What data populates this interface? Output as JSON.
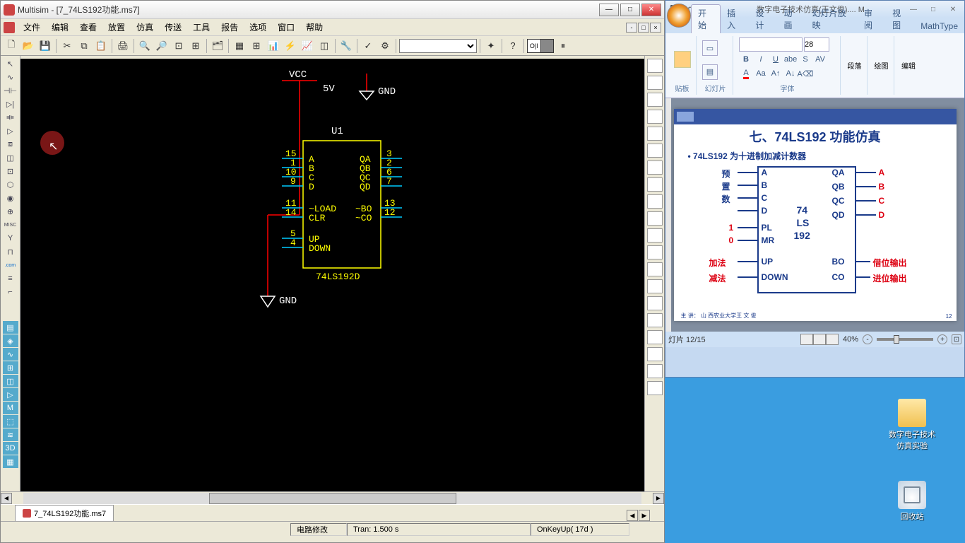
{
  "multisim": {
    "title": "Multisim - [7_74LS192功能.ms7]",
    "menus": [
      "文件",
      "编辑",
      "查看",
      "放置",
      "仿真",
      "传送",
      "工具",
      "报告",
      "选项",
      "窗口",
      "帮助"
    ],
    "file_tab": "7_74LS192功能.ms7",
    "statusbar": {
      "s1": "电路修改",
      "s2": "Tran: 1.500 s",
      "s3": "OnKeyUp( 17d )"
    },
    "circuit": {
      "vcc": "VCC",
      "vcc_val": "5V",
      "gnd": "GND",
      "ref": "U1",
      "chip": "74LS192D",
      "left_pins": [
        {
          "n": "15",
          "l": "A"
        },
        {
          "n": "1",
          "l": "B"
        },
        {
          "n": "10",
          "l": "C"
        },
        {
          "n": "9",
          "l": "D"
        },
        {
          "n": "11",
          "l": "~LOAD"
        },
        {
          "n": "14",
          "l": "CLR"
        },
        {
          "n": "5",
          "l": "UP"
        },
        {
          "n": "4",
          "l": "DOWN"
        }
      ],
      "right_pins": [
        {
          "n": "3",
          "l": "QA"
        },
        {
          "n": "2",
          "l": "QB"
        },
        {
          "n": "6",
          "l": "QC"
        },
        {
          "n": "7",
          "l": "QD"
        },
        {
          "n": "13",
          "l": "~BO"
        },
        {
          "n": "12",
          "l": "~CO"
        }
      ]
    }
  },
  "ppt": {
    "doc_title": "数字电子技术仿真(王文俊).... M",
    "tabs": [
      "开始",
      "插入",
      "设计",
      "动画",
      "幻灯片放映",
      "审阅",
      "视图",
      "MathType"
    ],
    "groups": {
      "clipboard": "贴板",
      "slides": "幻灯片",
      "font": "字体",
      "para": "段落",
      "draw": "绘图",
      "edit": "编辑"
    },
    "font_size": "28",
    "slide": {
      "title": "七、74LS192 功能仿真",
      "bullet": "• 74LS192 为十进制加减计数器",
      "left_labels_cn": [
        "预",
        "置",
        "数"
      ],
      "left_io": [
        "A",
        "B",
        "C",
        "D",
        "PL",
        "MR",
        "UP",
        "DOWN"
      ],
      "right_io": [
        "QA",
        "QB",
        "QC",
        "QD",
        "BO",
        "CO"
      ],
      "right_out": [
        "A",
        "B",
        "C",
        "D",
        "借位输出",
        "进位输出"
      ],
      "chip_lines": [
        "74",
        "LS",
        "192"
      ],
      "pl_val": "1",
      "mr_val": "0",
      "up_cn": "加法",
      "down_cn": "减法",
      "footer": "主 讲：   山 西农业大学王 文 俊",
      "pagenum": "12"
    },
    "status": {
      "slide": "灯片 12/15",
      "zoom": "40%"
    }
  },
  "desktop": {
    "folder": "数字电子技术仿真实验",
    "recycle": "回收站"
  }
}
